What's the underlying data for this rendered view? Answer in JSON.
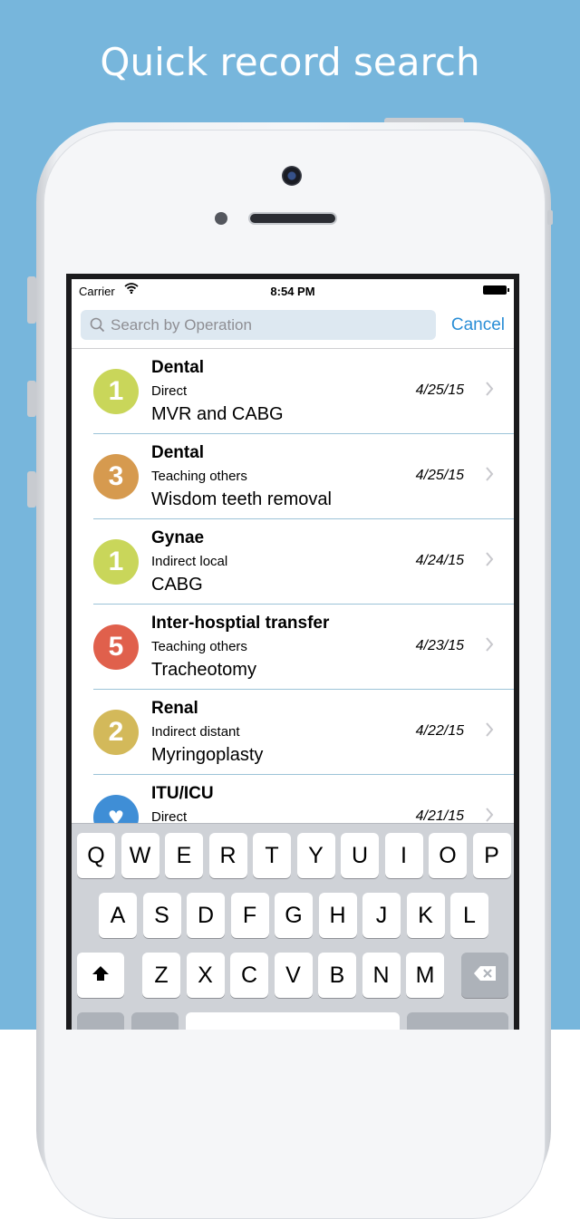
{
  "headline": "Quick record search",
  "status_bar": {
    "carrier": "Carrier",
    "time": "8:54 PM"
  },
  "search": {
    "placeholder": "Search by Operation",
    "cancel_label": "Cancel"
  },
  "records": [
    {
      "badge": "1",
      "badge_color": "#c9d65a",
      "title": "Dental",
      "subtitle": "Direct",
      "operation": "MVR and CABG",
      "date": "4/25/15"
    },
    {
      "badge": "3",
      "badge_color": "#d69a4f",
      "title": "Dental",
      "subtitle": "Teaching others",
      "operation": "Wisdom teeth removal",
      "date": "4/25/15"
    },
    {
      "badge": "1",
      "badge_color": "#c9d65a",
      "title": "Gynae",
      "subtitle": "Indirect local",
      "operation": "CABG",
      "date": "4/24/15"
    },
    {
      "badge": "5",
      "badge_color": "#e0604c",
      "title": "Inter-hosptial transfer",
      "subtitle": "Teaching others",
      "operation": "Tracheotomy",
      "date": "4/23/15"
    },
    {
      "badge": "2",
      "badge_color": "#d3b95a",
      "title": "Renal",
      "subtitle": "Indirect distant",
      "operation": "Myringoplasty",
      "date": "4/22/15"
    },
    {
      "badge": "♥",
      "badge_color": "#3f8ed6",
      "title": "ITU/ICU",
      "subtitle": "Direct",
      "operation": "",
      "date": "4/21/15"
    }
  ],
  "keyboard": {
    "row1": [
      "Q",
      "W",
      "E",
      "R",
      "T",
      "Y",
      "U",
      "I",
      "O",
      "P"
    ],
    "row2": [
      "A",
      "S",
      "D",
      "F",
      "G",
      "H",
      "J",
      "K",
      "L"
    ],
    "row3": [
      "Z",
      "X",
      "C",
      "V",
      "B",
      "N",
      "M"
    ]
  },
  "icons": {
    "wifi": "wifi-icon",
    "battery": "battery-icon",
    "search": "search-icon",
    "chevron": "chevron-right-icon",
    "shift": "shift-icon",
    "delete": "backspace-icon"
  }
}
